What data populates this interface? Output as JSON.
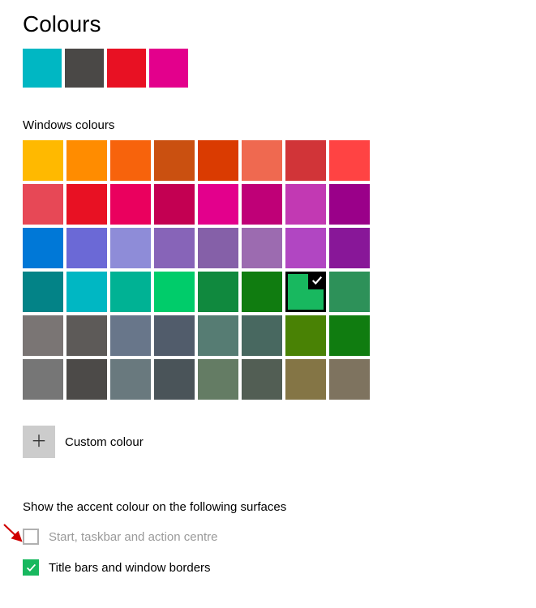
{
  "title": "Colours",
  "recent_colours": [
    "#00b7c3",
    "#4a4846",
    "#e81123",
    "#e3008c"
  ],
  "windows_colours_label": "Windows colours",
  "palette": [
    {
      "hex": "#ffb900"
    },
    {
      "hex": "#ff8c00"
    },
    {
      "hex": "#f7630c"
    },
    {
      "hex": "#ca5010"
    },
    {
      "hex": "#da3b01"
    },
    {
      "hex": "#ef6950"
    },
    {
      "hex": "#d13438"
    },
    {
      "hex": "#ff4343"
    },
    {
      "hex": "#e74856"
    },
    {
      "hex": "#e81123"
    },
    {
      "hex": "#ea005e"
    },
    {
      "hex": "#c30052"
    },
    {
      "hex": "#e3008c"
    },
    {
      "hex": "#bf0077"
    },
    {
      "hex": "#c239b3"
    },
    {
      "hex": "#9a0089"
    },
    {
      "hex": "#0078d7"
    },
    {
      "hex": "#6b69d6"
    },
    {
      "hex": "#8e8cd8"
    },
    {
      "hex": "#8764b8"
    },
    {
      "hex": "#8560a8"
    },
    {
      "hex": "#9c6bb0"
    },
    {
      "hex": "#b146c2"
    },
    {
      "hex": "#881798"
    },
    {
      "hex": "#038387"
    },
    {
      "hex": "#00b7c3"
    },
    {
      "hex": "#00b294"
    },
    {
      "hex": "#00cc6a"
    },
    {
      "hex": "#10893e"
    },
    {
      "hex": "#107c10"
    },
    {
      "hex": "#18b85f",
      "selected": true
    },
    {
      "hex": "#2d9159"
    },
    {
      "hex": "#7a7574"
    },
    {
      "hex": "#5d5a58"
    },
    {
      "hex": "#68768a"
    },
    {
      "hex": "#515c6b"
    },
    {
      "hex": "#567c73"
    },
    {
      "hex": "#486860"
    },
    {
      "hex": "#498205"
    },
    {
      "hex": "#107c10"
    },
    {
      "hex": "#767676"
    },
    {
      "hex": "#4c4a48"
    },
    {
      "hex": "#69797e"
    },
    {
      "hex": "#4a5459"
    },
    {
      "hex": "#647c64"
    },
    {
      "hex": "#525e54"
    },
    {
      "hex": "#847545"
    },
    {
      "hex": "#7e735f"
    }
  ],
  "custom_colour_label": "Custom colour",
  "surfaces_label": "Show the accent colour on the following surfaces",
  "checkbox_start": {
    "label": "Start, taskbar and action centre",
    "checked": false,
    "enabled": false
  },
  "checkbox_title": {
    "label": "Title bars and window borders",
    "checked": true,
    "enabled": true
  }
}
